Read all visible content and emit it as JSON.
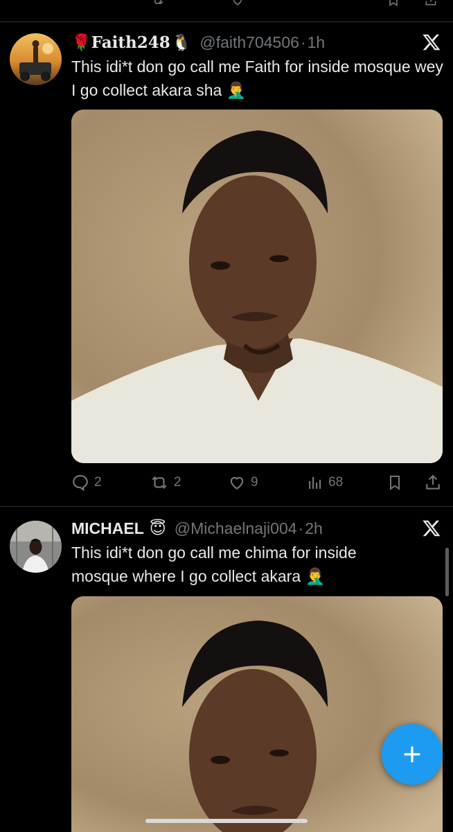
{
  "tweets": [
    {
      "name_prefix_emoji": "🌹",
      "name": "Faith248",
      "name_suffix_emoji": "🐧",
      "handle": "@faith704506",
      "separator": "·",
      "time": "1h",
      "text": "This idi*t don go call me Faith for inside mosque wey I go collect akara sha 🤦‍♂️",
      "stats": {
        "replies": "2",
        "reposts": "2",
        "likes": "9",
        "views": "68"
      }
    },
    {
      "name_prefix_emoji": "",
      "name": "MICHAEL",
      "name_suffix_emoji": "😇",
      "handle": "@Michaelnaji004",
      "separator": "·",
      "time": "2h",
      "text": "This idi*t don go call me chima for inside mosque where I go collect akara 🤦‍♂️"
    }
  ],
  "icons": {
    "reply": "reply-icon",
    "repost": "repost-icon",
    "like": "heart-icon",
    "views": "views-icon",
    "bookmark": "bookmark-icon",
    "share": "share-icon",
    "platform": "x-logo-icon",
    "compose": "plus-icon"
  },
  "colors": {
    "background": "#000000",
    "text": "#e7e9ea",
    "muted": "#71767b",
    "accent": "#1d9bf0",
    "divider": "#2f3336"
  }
}
